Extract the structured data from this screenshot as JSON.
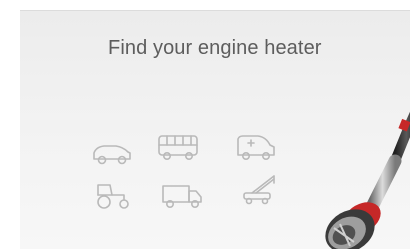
{
  "banner": {
    "title": "Find your engine heater"
  },
  "vehicles": [
    {
      "id": "car",
      "icon": "car-icon"
    },
    {
      "id": "bus",
      "icon": "bus-icon"
    },
    {
      "id": "ambulance",
      "icon": "ambulance-icon"
    },
    {
      "id": "tractor",
      "icon": "tractor-icon"
    },
    {
      "id": "truck",
      "icon": "truck-icon"
    },
    {
      "id": "crane",
      "icon": "crane-icon"
    }
  ],
  "product": {
    "icon": "engine-heater-icon"
  },
  "colors": {
    "title": "#5d5d5d",
    "icon_stroke": "#b9b9b9",
    "background": "#efefef"
  }
}
